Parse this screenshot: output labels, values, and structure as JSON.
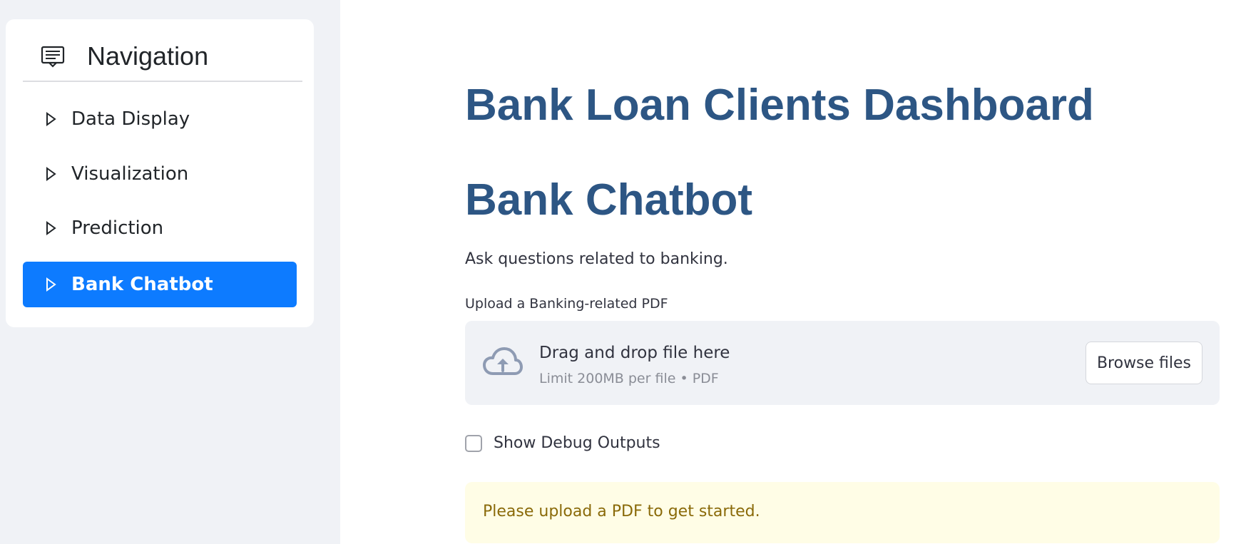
{
  "sidebar": {
    "title": "Navigation",
    "items": [
      {
        "label": "Data Display",
        "active": false
      },
      {
        "label": "Visualization",
        "active": false
      },
      {
        "label": "Prediction",
        "active": false
      },
      {
        "label": "Bank Chatbot",
        "active": true
      }
    ]
  },
  "main": {
    "title": "Bank Loan Clients Dashboard",
    "section_title": "Bank Chatbot",
    "subtitle": "Ask questions related to banking.",
    "uploader": {
      "label": "Upload a Banking-related PDF",
      "drop_text": "Drag and drop file here",
      "limit_text": "Limit 200MB per file • PDF",
      "browse_label": "Browse files"
    },
    "debug_checkbox": {
      "label": "Show Debug Outputs",
      "checked": false
    },
    "alert": {
      "text": "Please upload a PDF to get started."
    }
  },
  "colors": {
    "accent": "#0d7bff",
    "title": "#2d5684",
    "sidebar_bg": "#f0f2f6",
    "alert_bg": "#fffde6",
    "alert_text": "#8a6a09"
  },
  "icons": {
    "nav_header": "chat-menu-icon",
    "nav_item": "caret-right-icon",
    "upload": "cloud-upload-icon"
  }
}
